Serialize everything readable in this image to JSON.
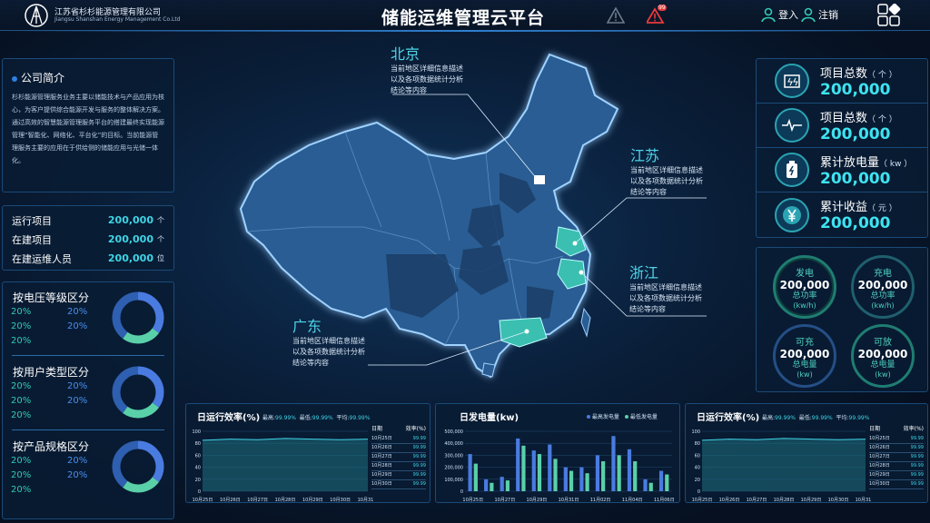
{
  "header": {
    "company_cn": "江苏省杉杉能源管理有限公司",
    "company_en": "Jiangsu Shanshan Energy Management Co.Ltd",
    "title": "储能运维管理云平台",
    "alarm_badge": "99",
    "login_label": "登入",
    "logout_label": "注销"
  },
  "intro": {
    "title": "公司简介",
    "text": "杉杉能源管理服务业务主要以储能技术与产品应用为核心，为客户提供综合能源开发与服务的整体解决方案。通过高效的智慧能源管理服务平台的搭建最终实现能源管理“智能化、网络化、平台化”的目标。当前能源管理服务主要的应用在于供给侧的储能应用与光储一体化。"
  },
  "stats": [
    {
      "label": "运行项目",
      "value": "200,000",
      "unit": "个"
    },
    {
      "label": "在建项目",
      "value": "200,000",
      "unit": "个"
    },
    {
      "label": "在建运维人员",
      "value": "200,000",
      "unit": "位"
    }
  ],
  "categories": [
    {
      "title": "按电压等级区分",
      "pcts": [
        "20%",
        "20%",
        "20%",
        "20%",
        "20%"
      ],
      "fractions": [
        0.35,
        0.25,
        0.4
      ]
    },
    {
      "title": "按用户类型区分",
      "pcts": [
        "20%",
        "20%",
        "20%",
        "20%",
        "20%"
      ],
      "fractions": [
        0.35,
        0.25,
        0.4
      ]
    },
    {
      "title": "按产品规格区分",
      "pcts": [
        "20%",
        "20%",
        "20%",
        "20%",
        "20%"
      ],
      "fractions": [
        0.35,
        0.25,
        0.4
      ]
    }
  ],
  "kpis": [
    {
      "label": "项目总数",
      "unit": "（ 个 ）",
      "value": "200,000",
      "icon": "battery-grid-icon"
    },
    {
      "label": "项目总数",
      "unit": "（ 个 ）",
      "value": "200,000",
      "icon": "pulse-icon"
    },
    {
      "label": "累计放电量",
      "unit": "（ kw ）",
      "value": "200,000",
      "icon": "battery-icon"
    },
    {
      "label": "累计收益",
      "unit": "（ 元 ）",
      "value": "200,000",
      "icon": "yen-icon"
    }
  ],
  "rings": [
    {
      "top": "发电",
      "value": "200,000",
      "sub": "总功率",
      "unit": "(kw/h)"
    },
    {
      "top": "充电",
      "value": "200,000",
      "sub": "总功率",
      "unit": "(kw/h)"
    },
    {
      "top": "可充",
      "value": "200,000",
      "sub": "总电量",
      "unit": "(kw)"
    },
    {
      "top": "可放",
      "value": "200,000",
      "sub": "总电量",
      "unit": "(kw)"
    }
  ],
  "cities": [
    {
      "name": "北京",
      "desc1": "当前地区详细信息描述",
      "desc2": "以及各项数据统计分析",
      "desc3": "结论等内容"
    },
    {
      "name": "江苏",
      "desc1": "当前地区详细信息描述",
      "desc2": "以及各项数据统计分析",
      "desc3": "结论等内容"
    },
    {
      "name": "浙江",
      "desc1": "当前地区详细信息描述",
      "desc2": "以及各项数据统计分析",
      "desc3": "结论等内容"
    },
    {
      "name": "广东",
      "desc1": "当前地区详细信息描述",
      "desc2": "以及各项数据统计分析",
      "desc3": "结论等内容"
    }
  ],
  "efficiency": {
    "title": "日运行效率(%)",
    "max_label": "最高:",
    "max": "99.99%",
    "min_label": "最低:",
    "min": "99.99%",
    "avg_label": "平均:",
    "avg": "99.99%",
    "table_head_date": "日期",
    "table_head_eff": "效率(%)",
    "rows": [
      [
        "10月25日",
        "99.99"
      ],
      [
        "10月26日",
        "99.99"
      ],
      [
        "10月27日",
        "99.99"
      ],
      [
        "10月28日",
        "99.99"
      ],
      [
        "10月29日",
        "99.99"
      ],
      [
        "10月30日",
        "99.99"
      ]
    ]
  },
  "colors": {
    "accent": "#3fd4e6",
    "green": "#34c8b4",
    "blue": "#4a8ff0",
    "panel_border": "#1b4a78"
  },
  "chart_data": [
    {
      "type": "area",
      "title": "日运行效率(%)",
      "x": [
        "10月25日",
        "10月26日",
        "10月27日",
        "10月28日",
        "10月29日",
        "10月30日",
        "10月31日"
      ],
      "values": [
        85,
        87,
        86,
        88,
        87,
        86,
        87
      ],
      "ylim": [
        0,
        100
      ],
      "yticks": [
        "0",
        "20",
        "40",
        "60",
        "80",
        "100"
      ]
    },
    {
      "type": "bar",
      "title": "日发电量(kw)",
      "categories": [
        "10月25日",
        "10月26日",
        "10月27日",
        "10月28日",
        "10月29日",
        "10月30日",
        "10月31日",
        "11月01日",
        "11月02日",
        "11月03日",
        "11月04日",
        "11月05日",
        "11月06日"
      ],
      "x_ticks": [
        "10月25日",
        "10月27日",
        "10月29日",
        "10月31日",
        "11月02日",
        "11月04日",
        "11月06日"
      ],
      "series": [
        {
          "name": "最高发电量",
          "color": "#4a7be0",
          "values": [
            310000,
            100000,
            120000,
            440000,
            340000,
            390000,
            200000,
            200000,
            300000,
            460000,
            350000,
            100000,
            170000
          ]
        },
        {
          "name": "最低发电量",
          "color": "#5ad0a8",
          "values": [
            230000,
            70000,
            90000,
            380000,
            310000,
            270000,
            170000,
            150000,
            250000,
            300000,
            250000,
            70000,
            140000
          ]
        }
      ],
      "ylim": [
        0,
        500000
      ],
      "yticks": [
        "0",
        "100,000",
        "200,000",
        "300,000",
        "400,000",
        "500,000"
      ]
    },
    {
      "type": "area",
      "title": "日运行效率(%)",
      "x": [
        "10月25日",
        "10月26日",
        "10月27日",
        "10月28日",
        "10月29日",
        "10月30日",
        "10月31日"
      ],
      "values": [
        85,
        87,
        86,
        88,
        87,
        86,
        87
      ],
      "ylim": [
        0,
        100
      ],
      "yticks": [
        "0",
        "20",
        "40",
        "60",
        "80",
        "100"
      ]
    }
  ]
}
